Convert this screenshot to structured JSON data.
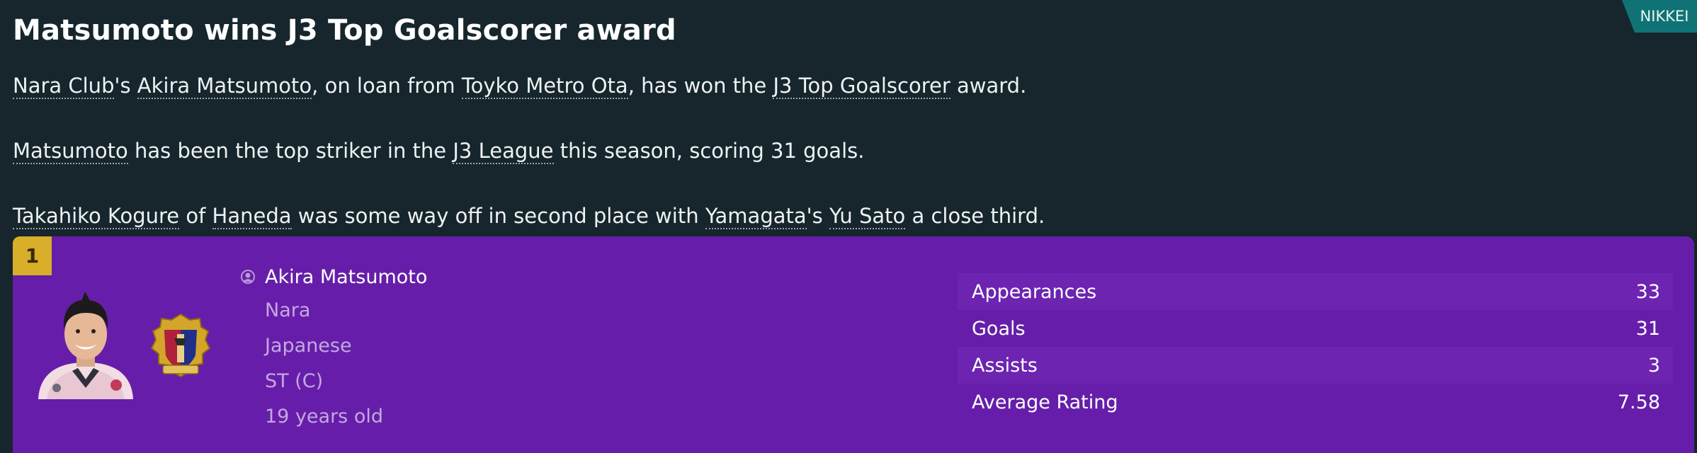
{
  "source": "NIKKEI",
  "headline": "Matsumoto wins J3 Top Goalscorer award",
  "paragraphs": {
    "p1": {
      "club": "Nara Club",
      "possessive": "'s ",
      "player": "Akira Matsumoto",
      "t1": ", on loan from ",
      "loan_club": "Toyko Metro Ota",
      "t2": ", has won the ",
      "award": "J3 Top Goalscorer",
      "t3": " award."
    },
    "p2": {
      "player": "Matsumoto",
      "t1": " has been the top striker in the ",
      "league": "J3 League",
      "t2": " this season, scoring 31 goals."
    },
    "p3": {
      "second": "Takahiko Kogure",
      "t1": " of ",
      "second_club": "Haneda",
      "t2": " was some way off in second place with ",
      "third_club": "Yamagata",
      "possessive": "'s ",
      "third": "Yu Sato",
      "t3": " a close third."
    }
  },
  "player_card": {
    "rank": "1",
    "name": "Akira Matsumoto",
    "club": "Nara",
    "nationality": "Japanese",
    "position": "ST (C)",
    "age": "19 years old",
    "icons": {
      "person": "person-icon",
      "crest": "club-crest-icon",
      "photo": "player-photo"
    },
    "stats": [
      {
        "label": "Appearances",
        "value": "33"
      },
      {
        "label": "Goals",
        "value": "31"
      },
      {
        "label": "Assists",
        "value": "3"
      },
      {
        "label": "Average Rating",
        "value": "7.58"
      }
    ]
  },
  "colors": {
    "background": "#16262c",
    "panel": "#661eaa",
    "badge": "#0f7375",
    "rank": "#d8ae2a"
  }
}
